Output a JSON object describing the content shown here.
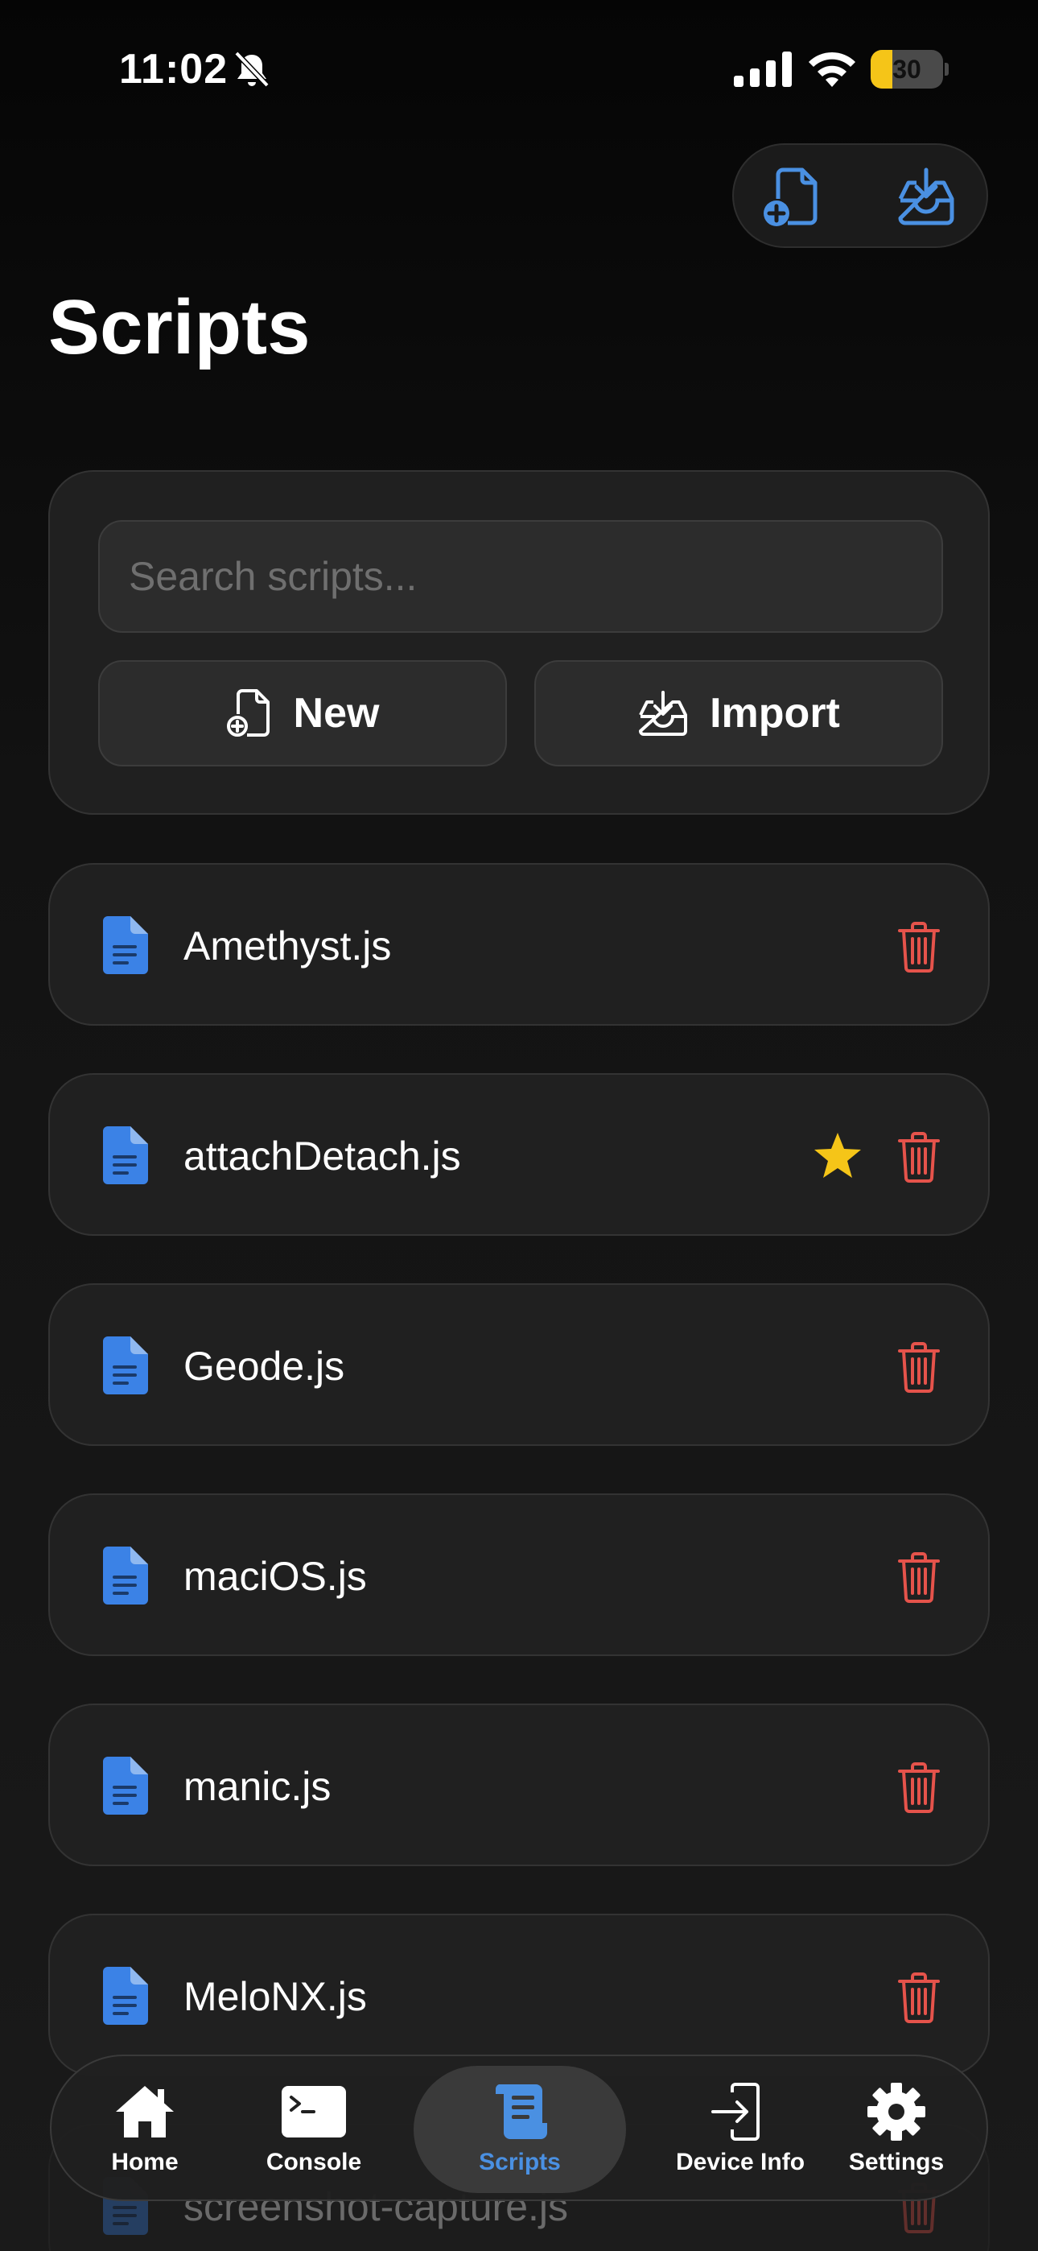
{
  "status_bar": {
    "time": "11:02",
    "battery": "30",
    "battery_level": 0.3
  },
  "header": {
    "title": "Scripts"
  },
  "search": {
    "placeholder": "Search scripts..."
  },
  "actions": {
    "new_label": "New",
    "import_label": "Import"
  },
  "scripts": [
    {
      "name": "Amethyst.js",
      "starred": false
    },
    {
      "name": "attachDetach.js",
      "starred": true
    },
    {
      "name": "Geode.js",
      "starred": false
    },
    {
      "name": "maciOS.js",
      "starred": false
    },
    {
      "name": "manic.js",
      "starred": false
    },
    {
      "name": "MeloNX.js",
      "starred": false
    },
    {
      "name": "screenshot-capture.js",
      "starred": false
    }
  ],
  "tabs": [
    {
      "label": "Home",
      "icon": "house-icon",
      "active": false
    },
    {
      "label": "Console",
      "icon": "terminal-icon",
      "active": false
    },
    {
      "label": "Scripts",
      "icon": "scroll-icon",
      "active": true
    },
    {
      "label": "Device Info",
      "icon": "device-enter-icon",
      "active": false
    },
    {
      "label": "Settings",
      "icon": "gear-icon",
      "active": false
    }
  ],
  "colors": {
    "accent": "#4a90e2",
    "file_icon": "#3b82e6",
    "trash": "#e5534b",
    "star": "#f5c518",
    "battery": "#f5c518"
  }
}
